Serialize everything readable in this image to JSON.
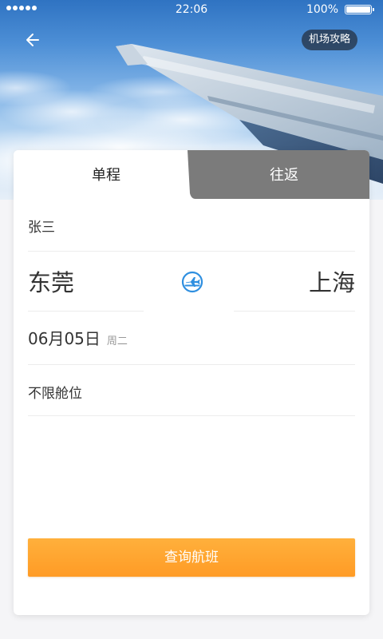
{
  "status_bar": {
    "time": "22:06",
    "battery": "100%"
  },
  "nav": {
    "guide_label": "机场攻略"
  },
  "tabs": [
    {
      "label": "单程",
      "selected": true
    },
    {
      "label": "往返",
      "selected": false
    }
  ],
  "form": {
    "passenger": "张三",
    "from_city": "东莞",
    "to_city": "上海",
    "date": "06月05日",
    "weekday": "周二",
    "cabin": "不限舱位"
  },
  "search_button": "查询航班",
  "colors": {
    "accent_orange": "#ff9f2a",
    "icon_blue": "#2f8fe0",
    "tab_inactive": "#7a7a7a"
  }
}
